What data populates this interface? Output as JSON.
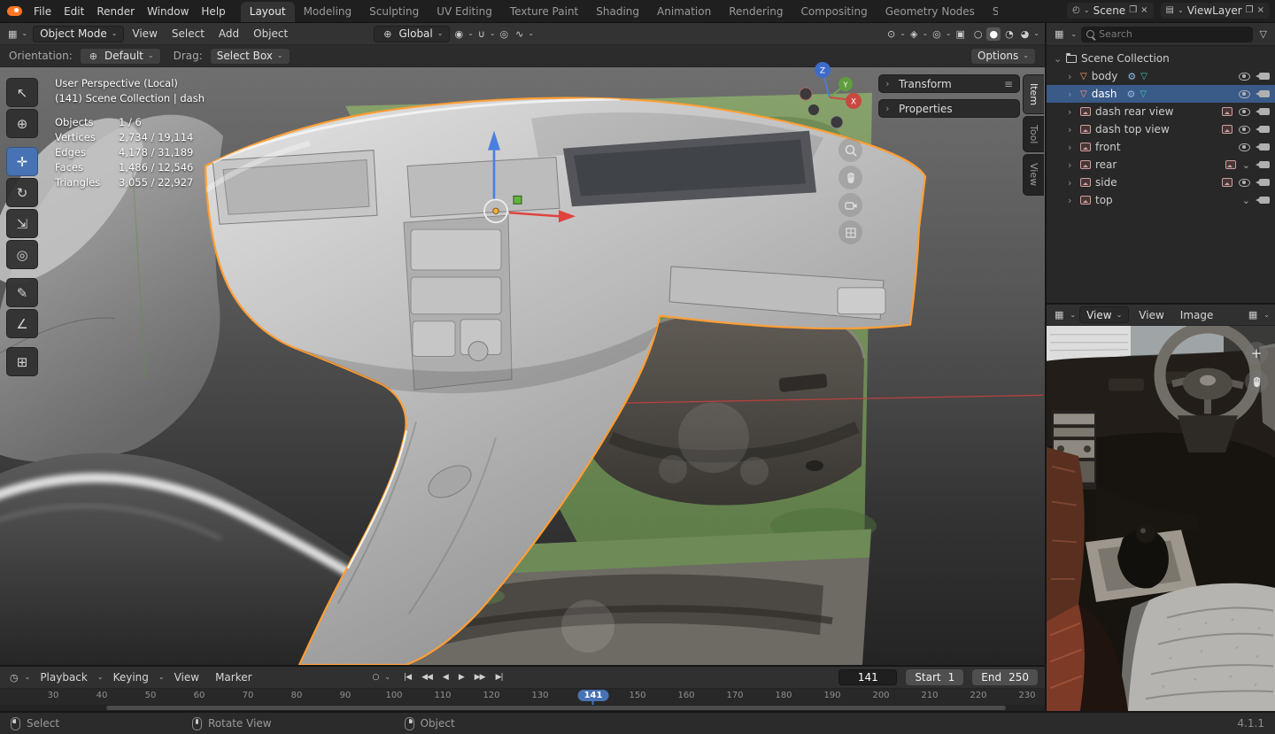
{
  "icons": {
    "dropdown": "⌄",
    "chevron": "›",
    "chevron_open": "⌄",
    "hamburger": "≡",
    "editor_grid": "▦",
    "global": "⊕",
    "pivot": "◉",
    "magnet": "∪",
    "prop_edit": "◎",
    "falloff": "∿",
    "vis_eye": "⊙",
    "gizmo": "◈",
    "overlays": "◎",
    "xray": "▣",
    "shade_wireframe": "○",
    "shade_solid": "●",
    "shade_material": "◔",
    "shade_rendered": "◕",
    "tool_select": "↖",
    "tool_cursor": "⊕",
    "tool_move": "✛",
    "tool_rotate": "↻",
    "tool_scale": "⇲",
    "tool_transform": "◎",
    "tool_annotate": "✎",
    "tool_measure": "∠",
    "tool_add_cube": "⊞",
    "clock": "◷",
    "record": "○",
    "jump_start": "|◀",
    "prev_keyframe": "◀◀",
    "prev_frame": "◀",
    "play": "▶",
    "next_keyframe": "▶▶",
    "jump_end": "▶|",
    "scene": "◴",
    "viewlayer": "▤",
    "new": "❐",
    "close": "×",
    "funnel": "▽",
    "mesh": "▽",
    "modifier": "⚙",
    "mesh_data": "▽"
  },
  "topbar": {
    "menus": [
      "File",
      "Edit",
      "Render",
      "Window",
      "Help"
    ],
    "tabs": [
      "Layout",
      "Modeling",
      "Sculpting",
      "UV Editing",
      "Texture Paint",
      "Shading",
      "Animation",
      "Rendering",
      "Compositing",
      "Geometry Nodes",
      "S"
    ],
    "active_tab": "Layout",
    "scene": "Scene",
    "viewlayer": "ViewLayer"
  },
  "viewport_header": {
    "mode": "Object Mode",
    "menus": [
      "View",
      "Select",
      "Add",
      "Object"
    ],
    "orientation": "Global"
  },
  "tool_settings": {
    "orientation_label": "Orientation:",
    "orientation_value": "Default",
    "drag_label": "Drag:",
    "drag_value": "Select Box",
    "options": "Options"
  },
  "viewport_overlay": {
    "view_label": "User Perspective (Local)",
    "context_label": "(141) Scene Collection | dash",
    "stats": [
      {
        "label": "Objects",
        "value": "1 / 6"
      },
      {
        "label": "Vertices",
        "value": "2,734 / 19,114"
      },
      {
        "label": "Edges",
        "value": "4,178 / 31,189"
      },
      {
        "label": "Faces",
        "value": "1,486 / 12,546"
      },
      {
        "label": "Triangles",
        "value": "3,055 / 22,927"
      }
    ]
  },
  "n_panel": {
    "sections": [
      "Transform",
      "Properties"
    ],
    "tabs": [
      "Item",
      "Tool",
      "View"
    ],
    "active_tab": "Item"
  },
  "axis_gizmo": {
    "x": "X",
    "y": "Y",
    "z": "Z"
  },
  "outliner": {
    "search_placeholder": "Search",
    "root": "Scene Collection",
    "items": [
      {
        "name": "body"
      },
      {
        "name": "dash"
      },
      {
        "name": "dash rear view"
      },
      {
        "name": "dash top view"
      },
      {
        "name": "front"
      },
      {
        "name": "rear"
      },
      {
        "name": "side"
      },
      {
        "name": "top"
      }
    ]
  },
  "image_editor": {
    "mode": "View",
    "menus": [
      "View",
      "Image"
    ]
  },
  "timeline": {
    "menus": [
      "Playback",
      "Keying",
      "View",
      "Marker"
    ],
    "current_frame": "141",
    "start_label": "Start",
    "start_value": "1",
    "end_label": "End",
    "end_value": "250",
    "ticks": [
      "30",
      "40",
      "50",
      "60",
      "70",
      "80",
      "90",
      "100",
      "110",
      "120",
      "130",
      "150",
      "160",
      "170",
      "180",
      "190",
      "200",
      "210",
      "220",
      "230"
    ]
  },
  "statusbar": {
    "hints": [
      "Select",
      "Rotate View",
      "Object"
    ],
    "version": "4.1.1"
  },
  "colors": {
    "accent_blue": "#4772b3",
    "selection_orange": "#ff9e35"
  }
}
